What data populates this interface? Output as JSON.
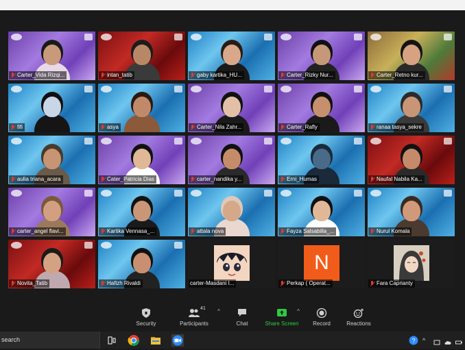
{
  "participants": [
    {
      "name": "Carter_Vida Rizqi...",
      "bg": "purple",
      "skin": "#c99a7a",
      "hair": "#1a1a1a",
      "shirt": "#e8d8e8"
    },
    {
      "name": "intan_tatib",
      "bg": "red",
      "skin": "#b88866",
      "hair": "#1c1c1c",
      "shirt": "#3a3a3a"
    },
    {
      "name": "gaby kartika_HU...",
      "bg": "blue",
      "skin": "#d9a88a",
      "hair": "#2a1c14",
      "shirt": "#1a1a1a"
    },
    {
      "name": "Carter_Rizky Nur...",
      "bg": "purple",
      "skin": "#c69878",
      "hair": "#111111",
      "shirt": "#222222"
    },
    {
      "name": "Carter_Retno kur...",
      "bg": "photo",
      "skin": "#d6a282",
      "hair": "#141414",
      "shirt": "#2a2a2a"
    },
    {
      "name": "fifi",
      "bg": "blue",
      "skin": "#c9d6e8",
      "hair": "#101010",
      "shirt": "#151515"
    },
    {
      "name": "asya",
      "bg": "blue",
      "skin": "#c08a6a",
      "hair": "#2a1a10",
      "shirt": "#8a5a3a"
    },
    {
      "name": "Carter_Nila Zahr...",
      "bg": "purple",
      "skin": "#e2c0a8",
      "hair": "#121212",
      "shirt": "#1a1a1a"
    },
    {
      "name": "Carter_Rafly",
      "bg": "purple",
      "skin": "#c68f6e",
      "hair": "#111111",
      "shirt": "#1a1a1a"
    },
    {
      "name": "ranaa tasya_sekre",
      "bg": "blue",
      "skin": "#c89676",
      "hair": "#2b2b2b",
      "shirt": "#3a3a3a"
    },
    {
      "name": "aulia triana_acara",
      "bg": "blue",
      "skin": "#c79474",
      "hair": "#4a3a2a",
      "shirt": "#6a5a4a"
    },
    {
      "name": "Cater_Patricia Dias",
      "bg": "purple",
      "skin": "#e0b898",
      "hair": "#111111",
      "shirt": "#ffffff"
    },
    {
      "name": "carter_nandika y...",
      "bg": "purple",
      "skin": "#c68c6a",
      "hair": "#111111",
      "shirt": "#2a2a2a"
    },
    {
      "name": "Erni_Humas",
      "bg": "blue",
      "skin": "#4a6a8a",
      "hair": "#1a2a3a",
      "shirt": "#1a2a3a"
    },
    {
      "name": "Naufal Nabila Ka...",
      "bg": "red",
      "skin": "#c48a6a",
      "hair": "#111111",
      "shirt": "#2a2a2a"
    },
    {
      "name": "carter_angel flavi...",
      "bg": "purple",
      "skin": "#d2a080",
      "hair": "#7a5a3a",
      "shirt": "#9a7a5a"
    },
    {
      "name": "Kartika Vennasa_...",
      "bg": "blue",
      "skin": "#c99678",
      "hair": "#111111",
      "shirt": "#1a1a1a"
    },
    {
      "name": "attala nova",
      "bg": "blue",
      "skin": "#d4a888",
      "hair": "#e0c8b8",
      "shirt": "#e8d8d0"
    },
    {
      "name": "Fayza Salsabilla_...",
      "bg": "blue",
      "skin": "#e0b898",
      "hair": "#111111",
      "shirt": "#ffffff"
    },
    {
      "name": "Nurul Komala",
      "bg": "blue",
      "skin": "#d09a7a",
      "hair": "#3a2a20",
      "shirt": "#4a3a30"
    },
    {
      "name": "Novita_Tatib",
      "bg": "red",
      "skin": "#d4a282",
      "hair": "#1a1a1a",
      "shirt": "#c0a8b0"
    },
    {
      "name": "Hafizh Rivaldi",
      "bg": "blue",
      "skin": "#c89070",
      "hair": "#111111",
      "shirt": "#222222"
    },
    {
      "name": "carter-Masdani I...",
      "bg": "dark",
      "avatar": "anime",
      "avatar_color": "#f3d6c0"
    },
    {
      "name": "Perkap ( Operat...",
      "bg": "dark",
      "avatar": "letter",
      "letter": "N",
      "avatar_color": "#f25c1a"
    },
    {
      "name": "Fara Caprianty",
      "bg": "dark",
      "avatar": "drawing",
      "avatar_color": "#d8cfc0"
    }
  ],
  "toolbar": {
    "security": "Security",
    "participants": "Participants",
    "participants_count": "41",
    "chat": "Chat",
    "share_screen": "Share Screen",
    "record": "Record",
    "reactions": "Reactions"
  },
  "taskbar": {
    "search": "search"
  },
  "colors": {
    "share_green": "#2ecc40",
    "mic_red": "#e53935",
    "zoom_blue": "#2d8cff"
  }
}
